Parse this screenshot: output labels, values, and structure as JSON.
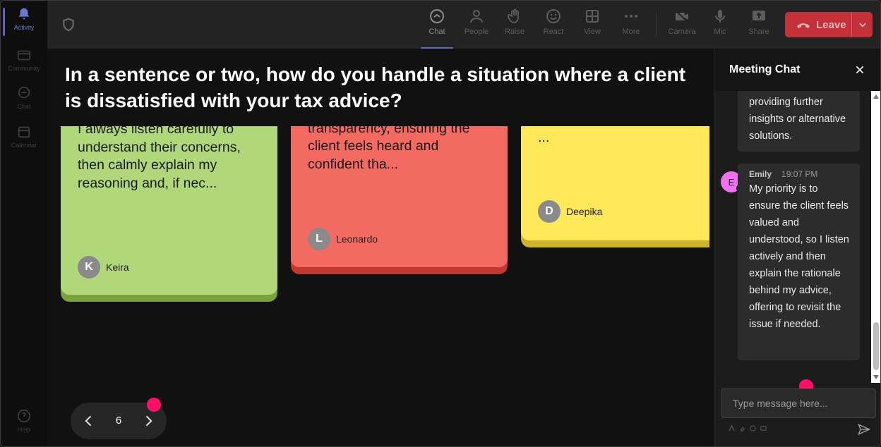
{
  "rail": {
    "items": [
      {
        "label": "Activity",
        "icon": "bell-icon",
        "active": true
      },
      {
        "label": "Community",
        "icon": "community-icon"
      },
      {
        "label": "Chat",
        "icon": "chat-icon"
      },
      {
        "label": "Calendar",
        "icon": "calendar-icon"
      }
    ],
    "help_label": "Help"
  },
  "toolbar": {
    "chat": "Chat",
    "people": "People",
    "raise": "Raise",
    "react": "React",
    "view": "View",
    "more": "More",
    "camera": "Camera",
    "mic": "Mic",
    "share": "Share",
    "leave": "Leave"
  },
  "question": "In a sentence or two, how do you handle a situation where a client is dissatisfied with your tax advice?",
  "cards": [
    {
      "text": "I always listen carefully to understand their concerns, then calmly explain my reasoning and, if nec...",
      "author": "Keira",
      "initial": "K",
      "color": "#b0d77a",
      "shade": "#7aa13e"
    },
    {
      "text": "communication and transparency, ensuring the client feels heard and confident tha...",
      "author": "Leonardo",
      "initial": "L",
      "color": "#f26a62",
      "shade": "#c2372f"
    },
    {
      "text": "...",
      "author": "Deepika",
      "initial": "D",
      "color": "#ffe85a",
      "shade": "#cdb22d"
    }
  ],
  "pager": {
    "page": "6"
  },
  "chat": {
    "title": "Meeting Chat",
    "messages": [
      {
        "text": "providing further insights or alternative solutions."
      },
      {
        "name": "Emily",
        "time": "19:07 PM",
        "initial": "E",
        "text": "My priority is to ensure the client feels valued and understood, so I listen actively and then explain the rationale behind my advice, offering to revisit the issue if needed."
      }
    ],
    "input_placeholder": "Type message here..."
  }
}
